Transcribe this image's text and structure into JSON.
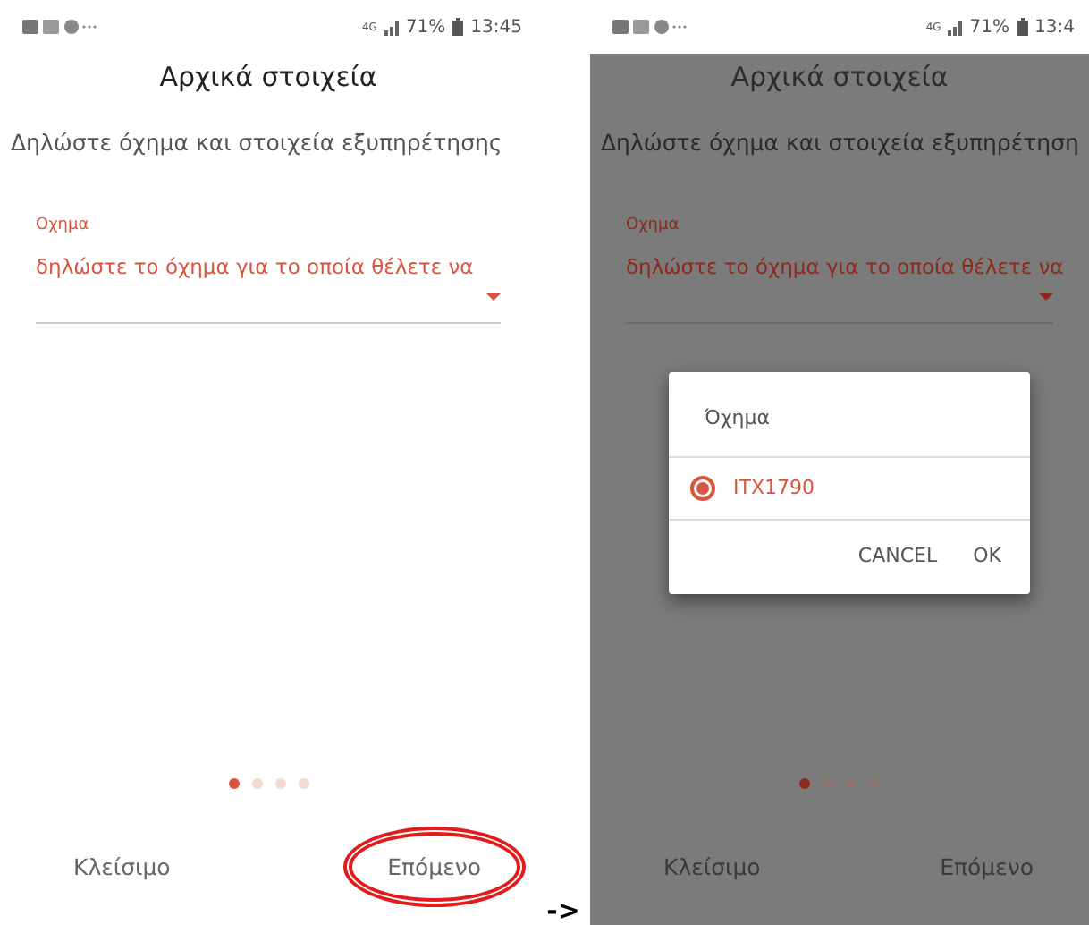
{
  "screens": [
    {
      "dimmed": false,
      "status_bar": {
        "network": "4G",
        "battery": "71%",
        "time": "13:45"
      },
      "title": "Αρχικά στοιχεία",
      "subtitle": "Δηλώστε όχημα και στοιχεία εξυπηρέτησης",
      "field": {
        "label": "Οχημα",
        "value": "δηλώστε το όχημα για το οποία θέλετε να"
      },
      "pager": [
        {
          "selected": true
        },
        {
          "selected": false
        },
        {
          "selected": false
        },
        {
          "selected": false
        }
      ],
      "buttons": [
        {
          "label": "Κλείσιμο",
          "highlighted": false
        },
        {
          "label": "Επόμενο",
          "highlighted": true
        }
      ]
    },
    {
      "dimmed": true,
      "status_bar": {
        "network": "4G",
        "battery": "71%",
        "time": "13:4"
      },
      "title": "Αρχικά στοιχεία",
      "subtitle": "Δηλώστε όχημα και στοιχεία εξυπηρέτηση",
      "field": {
        "label": "Οχημα",
        "value": "δηλώστε το όχημα για το οποία θέλετε να"
      },
      "pager": [
        {
          "selected": true
        },
        {
          "selected": false
        },
        {
          "selected": false
        },
        {
          "selected": false
        }
      ],
      "buttons": [
        {
          "label": "Κλείσιμο",
          "highlighted": false
        },
        {
          "label": "Επόμενο",
          "highlighted": false
        }
      ],
      "dialog": {
        "title": "Όχημα",
        "options": [
          {
            "label": "ITX1790",
            "selected": true
          }
        ],
        "buttons": [
          "CANCEL",
          "OK"
        ]
      }
    }
  ],
  "transition_arrow": "->"
}
